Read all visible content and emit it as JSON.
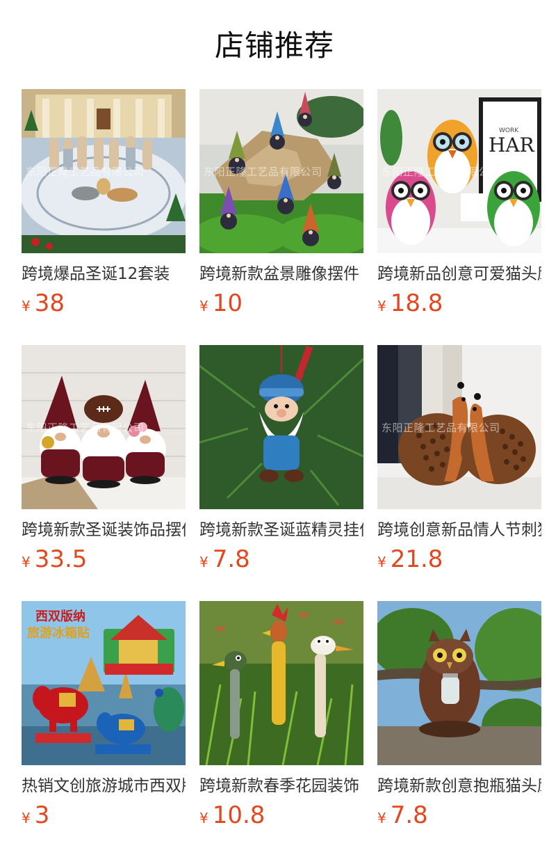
{
  "page": {
    "title": "店铺推荐"
  },
  "currency_symbol": "¥",
  "watermark": "东阳正隆工艺品有限公司",
  "products": [
    {
      "name": "跨境爆品圣诞12套装",
      "price": "38",
      "image": "nativity-set",
      "watermark_visible": true
    },
    {
      "name": "跨境新款盆景雕像摆件",
      "price": "10",
      "image": "garden-gnomes-moss",
      "watermark_visible": true
    },
    {
      "name": "跨境新品创意可爱猫头鹰",
      "price": "18.8",
      "image": "colorful-owls",
      "watermark_visible": true
    },
    {
      "name": "跨境新款圣诞装饰品摆件",
      "price": "33.5",
      "image": "football-gnomes",
      "watermark_visible": true
    },
    {
      "name": "跨境新款圣诞蓝精灵挂件",
      "price": "7.8",
      "image": "blue-gnome-ornament",
      "watermark_visible": false
    },
    {
      "name": "跨境创意新品情人节刺猬",
      "price": "21.8",
      "image": "hedgehog-couple",
      "watermark_visible": true
    },
    {
      "name": "热销文创旅游城市西双版纳",
      "price": "3",
      "image": "xishuangbanna-magnets",
      "watermark_visible": false
    },
    {
      "name": "跨境新款春季花园装饰",
      "price": "10.8",
      "image": "garden-bird-stakes",
      "watermark_visible": false
    },
    {
      "name": "跨境新款创意抱瓶猫头鹰",
      "price": "7.8",
      "image": "owl-holding-jar",
      "watermark_visible": false
    }
  ]
}
